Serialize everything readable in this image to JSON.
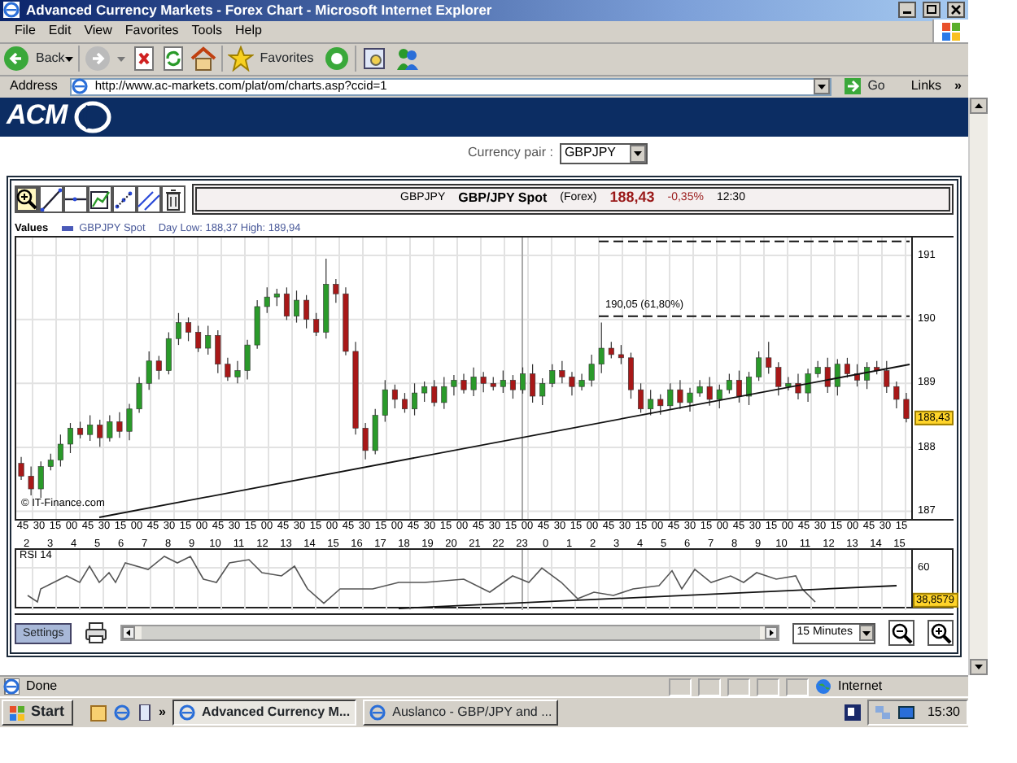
{
  "window": {
    "title": "Advanced Currency Markets - Forex Chart - Microsoft Internet Explorer"
  },
  "menu": [
    "File",
    "Edit",
    "View",
    "Favorites",
    "Tools",
    "Help"
  ],
  "toolbar": {
    "back": "Back",
    "favorites": "Favorites"
  },
  "address": {
    "label": "Address",
    "url": "http://www.ac-markets.com/plat/om/charts.asp?ccid=1",
    "go": "Go",
    "links": "Links",
    "chevron": "»"
  },
  "banner": {
    "logo": "ACM"
  },
  "currency_pair": {
    "label": "Currency pair :",
    "value": "GBPJPY"
  },
  "tools": [
    {
      "kind": "zoom",
      "selected": true
    },
    {
      "kind": "line",
      "selected": false
    },
    {
      "kind": "hline",
      "selected": false
    },
    {
      "kind": "frame",
      "selected": false
    },
    {
      "kind": "dots",
      "selected": false
    },
    {
      "kind": "parallel",
      "selected": false
    },
    {
      "kind": "trash",
      "selected": false
    }
  ],
  "chart_header": {
    "symbol": "GBPJPY",
    "name": "GBP/JPY Spot",
    "market": "(Forex)",
    "price": "188,43",
    "change": "-0,35%",
    "time": "12:30"
  },
  "values_bar": {
    "label": "Values",
    "series": "GBPJPY Spot",
    "stats": "Day Low: 188,37 High: 189,94"
  },
  "price_chart": {
    "chart_data": {
      "type": "candlestick",
      "grid": true,
      "ylim": [
        186.88,
        191.28
      ],
      "ref_lines": [
        {
          "axis": "y",
          "value": 191.22
        },
        {
          "axis": "y",
          "value": 190.05
        }
      ],
      "yticks": [
        {
          "value": 187,
          "label": "187"
        },
        {
          "value": 188,
          "label": "188"
        },
        {
          "value": 189,
          "label": "189"
        },
        {
          "value": 190,
          "label": "190"
        },
        {
          "value": 191,
          "label": "191"
        }
      ],
      "categories": [
        null,
        null,
        null,
        null,
        null,
        null,
        null,
        null,
        null,
        null,
        null,
        null,
        null,
        null,
        null,
        null,
        null,
        null,
        null,
        null,
        null,
        null,
        null,
        null,
        null,
        null,
        null,
        null,
        null,
        null,
        null,
        null,
        null,
        null,
        null,
        null,
        null,
        null,
        null,
        null,
        null,
        null,
        null,
        null,
        null,
        null,
        null,
        null,
        null,
        null,
        null,
        null,
        null,
        null,
        null,
        null,
        null,
        null,
        null,
        null,
        null,
        null,
        null,
        null,
        null,
        null,
        null,
        null,
        null,
        null,
        null,
        null,
        null,
        null,
        null,
        null,
        null,
        null,
        null,
        null,
        null,
        null,
        null,
        null,
        null,
        null,
        null,
        null,
        null,
        null,
        null
      ],
      "ohlc": [
        [
          187.75,
          187.85,
          187.49,
          187.55
        ],
        [
          187.55,
          187.7,
          187.25,
          187.35
        ],
        [
          187.35,
          187.78,
          187.21,
          187.7
        ],
        [
          187.7,
          187.9,
          187.64,
          187.8
        ],
        [
          187.8,
          188.2,
          187.7,
          188.05
        ],
        [
          188.05,
          188.38,
          187.91,
          188.3
        ],
        [
          188.3,
          188.4,
          188.14,
          188.2
        ],
        [
          188.2,
          188.5,
          188.1,
          188.35
        ],
        [
          188.35,
          188.43,
          188.01,
          188.15
        ],
        [
          188.15,
          188.5,
          188.09,
          188.4
        ],
        [
          188.4,
          188.55,
          188.15,
          188.25
        ],
        [
          188.25,
          188.68,
          188.11,
          188.6
        ],
        [
          188.6,
          189.1,
          188.54,
          189.0
        ],
        [
          189.0,
          189.5,
          188.9,
          189.35
        ],
        [
          189.35,
          189.43,
          189.06,
          189.2
        ],
        [
          189.2,
          189.8,
          189.14,
          189.7
        ],
        [
          189.7,
          190.1,
          189.6,
          189.95
        ],
        [
          189.95,
          190.03,
          189.66,
          189.8
        ],
        [
          189.8,
          189.9,
          189.49,
          189.55
        ],
        [
          189.55,
          189.9,
          189.45,
          189.75
        ],
        [
          189.75,
          189.83,
          189.16,
          189.3
        ],
        [
          189.3,
          189.4,
          189.04,
          189.1
        ],
        [
          189.1,
          189.35,
          189.0,
          189.2
        ],
        [
          189.2,
          189.68,
          189.06,
          189.6
        ],
        [
          189.6,
          190.3,
          189.54,
          190.2
        ],
        [
          190.2,
          190.5,
          190.1,
          190.35
        ],
        [
          190.35,
          190.48,
          190.21,
          190.4
        ],
        [
          190.4,
          190.5,
          189.99,
          190.05
        ],
        [
          190.05,
          190.45,
          189.95,
          190.3
        ],
        [
          190.3,
          190.38,
          189.86,
          190.0
        ],
        [
          190.0,
          190.1,
          189.74,
          189.8
        ],
        [
          189.8,
          190.95,
          189.7,
          190.55
        ],
        [
          190.55,
          190.63,
          190.26,
          190.4
        ],
        [
          190.4,
          190.5,
          189.44,
          189.5
        ],
        [
          189.5,
          189.65,
          188.2,
          188.3
        ],
        [
          188.3,
          188.38,
          187.81,
          187.95
        ],
        [
          187.95,
          188.6,
          187.89,
          188.5
        ],
        [
          188.5,
          189.05,
          188.4,
          188.9
        ],
        [
          188.9,
          188.98,
          188.61,
          188.75
        ],
        [
          188.75,
          188.85,
          188.54,
          188.6
        ],
        [
          188.6,
          189.0,
          188.5,
          188.85
        ],
        [
          188.85,
          189.03,
          188.71,
          188.95
        ],
        [
          188.95,
          189.05,
          188.64,
          188.7
        ],
        [
          188.7,
          189.1,
          188.6,
          188.95
        ],
        [
          188.95,
          189.13,
          188.81,
          189.05
        ],
        [
          189.05,
          189.15,
          188.84,
          188.9
        ],
        [
          188.9,
          189.25,
          188.8,
          189.1
        ],
        [
          189.1,
          189.18,
          188.86,
          189.0
        ],
        [
          189.0,
          189.1,
          188.89,
          188.95
        ],
        [
          188.95,
          189.2,
          188.85,
          189.05
        ],
        [
          189.05,
          189.13,
          188.76,
          188.9
        ],
        [
          188.9,
          189.25,
          188.84,
          189.15
        ],
        [
          189.15,
          189.3,
          188.7,
          188.8
        ],
        [
          188.8,
          189.08,
          188.66,
          189.0
        ],
        [
          189.0,
          189.3,
          188.94,
          189.2
        ],
        [
          189.2,
          189.35,
          189.0,
          189.1
        ],
        [
          189.1,
          189.18,
          188.81,
          188.95
        ],
        [
          188.95,
          189.15,
          188.89,
          189.05
        ],
        [
          189.05,
          189.45,
          188.95,
          189.3
        ],
        [
          189.3,
          189.95,
          189.16,
          189.55
        ],
        [
          189.55,
          189.65,
          189.39,
          189.45
        ],
        [
          189.45,
          189.6,
          189.3,
          189.4
        ],
        [
          189.4,
          189.48,
          188.76,
          188.9
        ],
        [
          188.9,
          189.0,
          188.54,
          188.6
        ],
        [
          188.6,
          188.9,
          188.5,
          188.75
        ],
        [
          188.75,
          188.83,
          188.51,
          188.65
        ],
        [
          188.65,
          189.0,
          188.59,
          188.9
        ],
        [
          188.9,
          189.05,
          188.6,
          188.7
        ],
        [
          188.7,
          188.93,
          188.56,
          188.85
        ],
        [
          188.85,
          189.05,
          188.79,
          188.95
        ],
        [
          188.95,
          189.1,
          188.65,
          188.75
        ],
        [
          188.75,
          188.98,
          188.61,
          188.9
        ],
        [
          188.9,
          189.15,
          188.84,
          189.05
        ],
        [
          189.05,
          189.2,
          188.7,
          188.8
        ],
        [
          188.8,
          189.18,
          188.66,
          189.1
        ],
        [
          189.1,
          189.5,
          189.04,
          189.4
        ],
        [
          189.4,
          189.65,
          189.15,
          189.25
        ],
        [
          189.25,
          189.33,
          188.81,
          188.95
        ],
        [
          188.95,
          189.1,
          188.89,
          189.0
        ],
        [
          189.0,
          189.15,
          188.75,
          188.85
        ],
        [
          188.85,
          189.23,
          188.71,
          189.15
        ],
        [
          189.15,
          189.35,
          189.09,
          189.25
        ],
        [
          189.25,
          189.4,
          188.85,
          188.95
        ],
        [
          188.95,
          189.38,
          188.81,
          189.3
        ],
        [
          189.3,
          189.4,
          189.09,
          189.15
        ],
        [
          189.15,
          189.3,
          188.95,
          189.05
        ],
        [
          189.05,
          189.33,
          188.91,
          189.25
        ],
        [
          189.25,
          189.35,
          189.14,
          189.2
        ],
        [
          189.2,
          189.35,
          188.85,
          188.95
        ],
        [
          188.95,
          189.03,
          188.61,
          188.75
        ],
        [
          188.75,
          188.85,
          188.39,
          188.45
        ]
      ]
    },
    "price_tag": "188,43",
    "fib_label": "190,05 (61,80%)",
    "copyright": "© IT-Finance.com"
  },
  "time_axis": {
    "minutes": [
      "45",
      "30",
      "15",
      "00",
      "45",
      "30",
      "15",
      "00",
      "45",
      "30",
      "15",
      "00",
      "45",
      "30",
      "15",
      "00",
      "45",
      "30",
      "15",
      "00",
      "45",
      "30",
      "15",
      "00",
      "45",
      "30",
      "15",
      "00",
      "45",
      "30",
      "15",
      "00",
      "45",
      "30",
      "15",
      "00",
      "45",
      "30",
      "15",
      "00",
      "45",
      "30",
      "15",
      "00",
      "45",
      "30",
      "15",
      "00",
      "45",
      "30",
      "15",
      "00",
      "45",
      "30",
      "15"
    ],
    "hours": [
      "2",
      "3",
      "4",
      "5",
      "6",
      "7",
      "8",
      "9",
      "10",
      "11",
      "12",
      "13",
      "14",
      "15",
      "16",
      "17",
      "18",
      "19",
      "20",
      "21",
      "22",
      "23",
      "0",
      "1",
      "2",
      "3",
      "4",
      "5",
      "6",
      "7",
      "8",
      "9",
      "10",
      "11",
      "12",
      "13",
      "14",
      "15"
    ]
  },
  "rsi": {
    "title": "RSI 14",
    "tick": "60",
    "value": "38,8579"
  },
  "controls": {
    "settings": "Settings",
    "interval": "15 Minutes"
  },
  "status": {
    "text": "Done",
    "zone": "Internet"
  },
  "taskbar": {
    "start": "Start",
    "chevron": "»",
    "tasks": [
      {
        "label": "Advanced Currency M...",
        "selected": true
      },
      {
        "label": "Auslanco - GBP/JPY and ...",
        "selected": false
      }
    ],
    "clock": "15:30"
  }
}
